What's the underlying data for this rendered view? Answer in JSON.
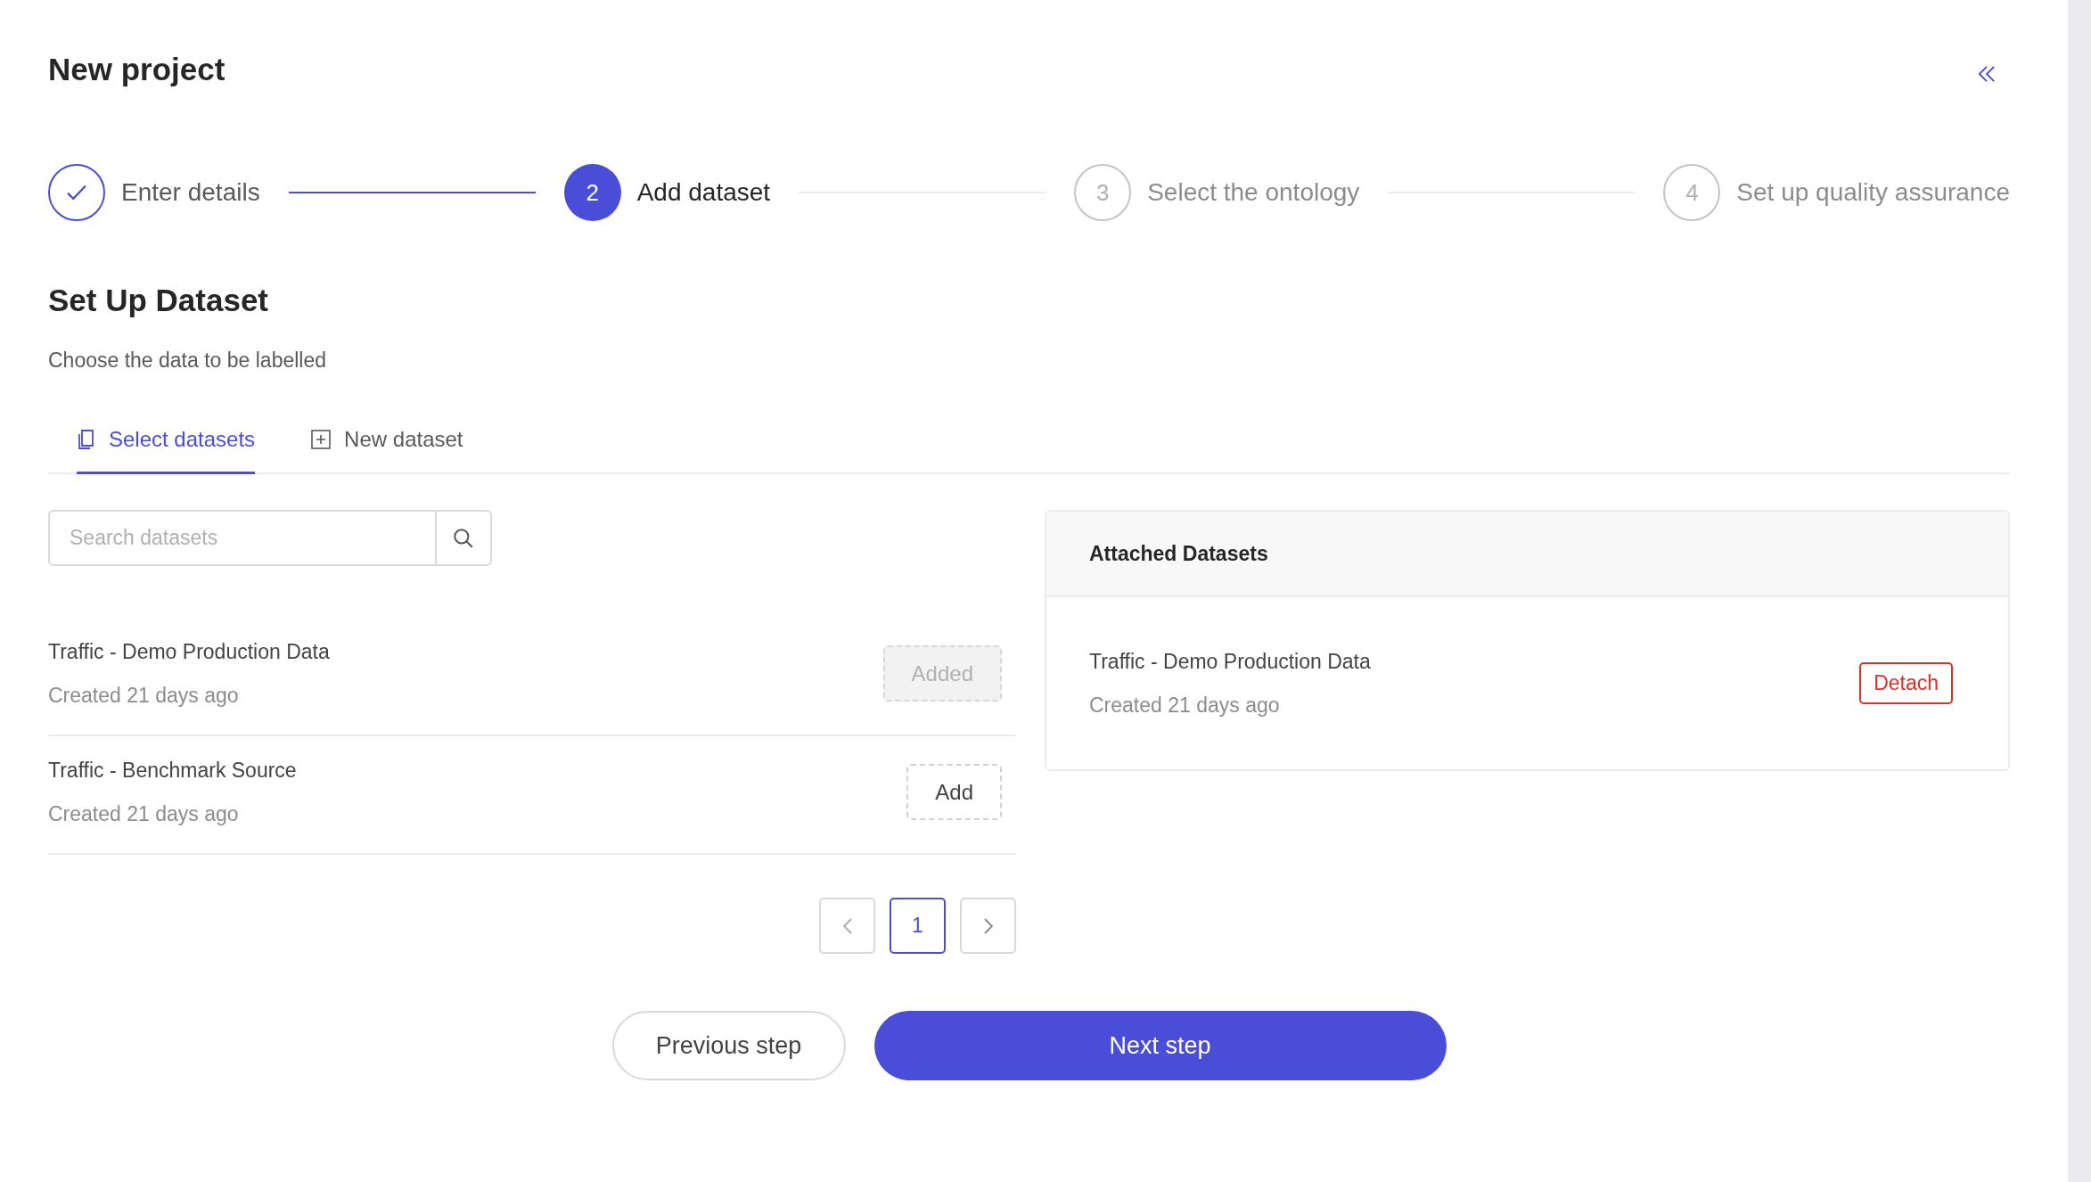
{
  "header": {
    "title": "New project"
  },
  "steps": [
    {
      "label": "Enter details",
      "done": true,
      "selected": false
    },
    {
      "number": "2",
      "label": "Add dataset",
      "done": false,
      "selected": true
    },
    {
      "number": "3",
      "label": "Select the ontology",
      "done": false,
      "selected": false
    },
    {
      "number": "4",
      "label": "Set up quality assurance",
      "done": false,
      "selected": false
    }
  ],
  "section": {
    "title": "Set Up Dataset",
    "subtitle": "Choose the data to be labelled"
  },
  "tabs": [
    {
      "label": "Select datasets",
      "selected": true
    },
    {
      "label": "New dataset",
      "selected": false
    }
  ],
  "search": {
    "placeholder": "Search datasets"
  },
  "datasets": [
    {
      "name": "Traffic - Demo Production Data",
      "created": "Created 21 days ago",
      "action": "Added",
      "disabled": true
    },
    {
      "name": "Traffic - Benchmark Source",
      "created": "Created 21 days ago",
      "action": "Add",
      "disabled": false
    }
  ],
  "pagination": {
    "pages": [
      {
        "label": "1",
        "selected": true
      }
    ]
  },
  "attached": {
    "title": "Attached Datasets",
    "items": [
      {
        "name": "Traffic - Demo Production Data",
        "created": "Created 21 days ago",
        "action": "Detach"
      }
    ]
  },
  "footer": {
    "previous": "Previous step",
    "next": "Next step"
  }
}
